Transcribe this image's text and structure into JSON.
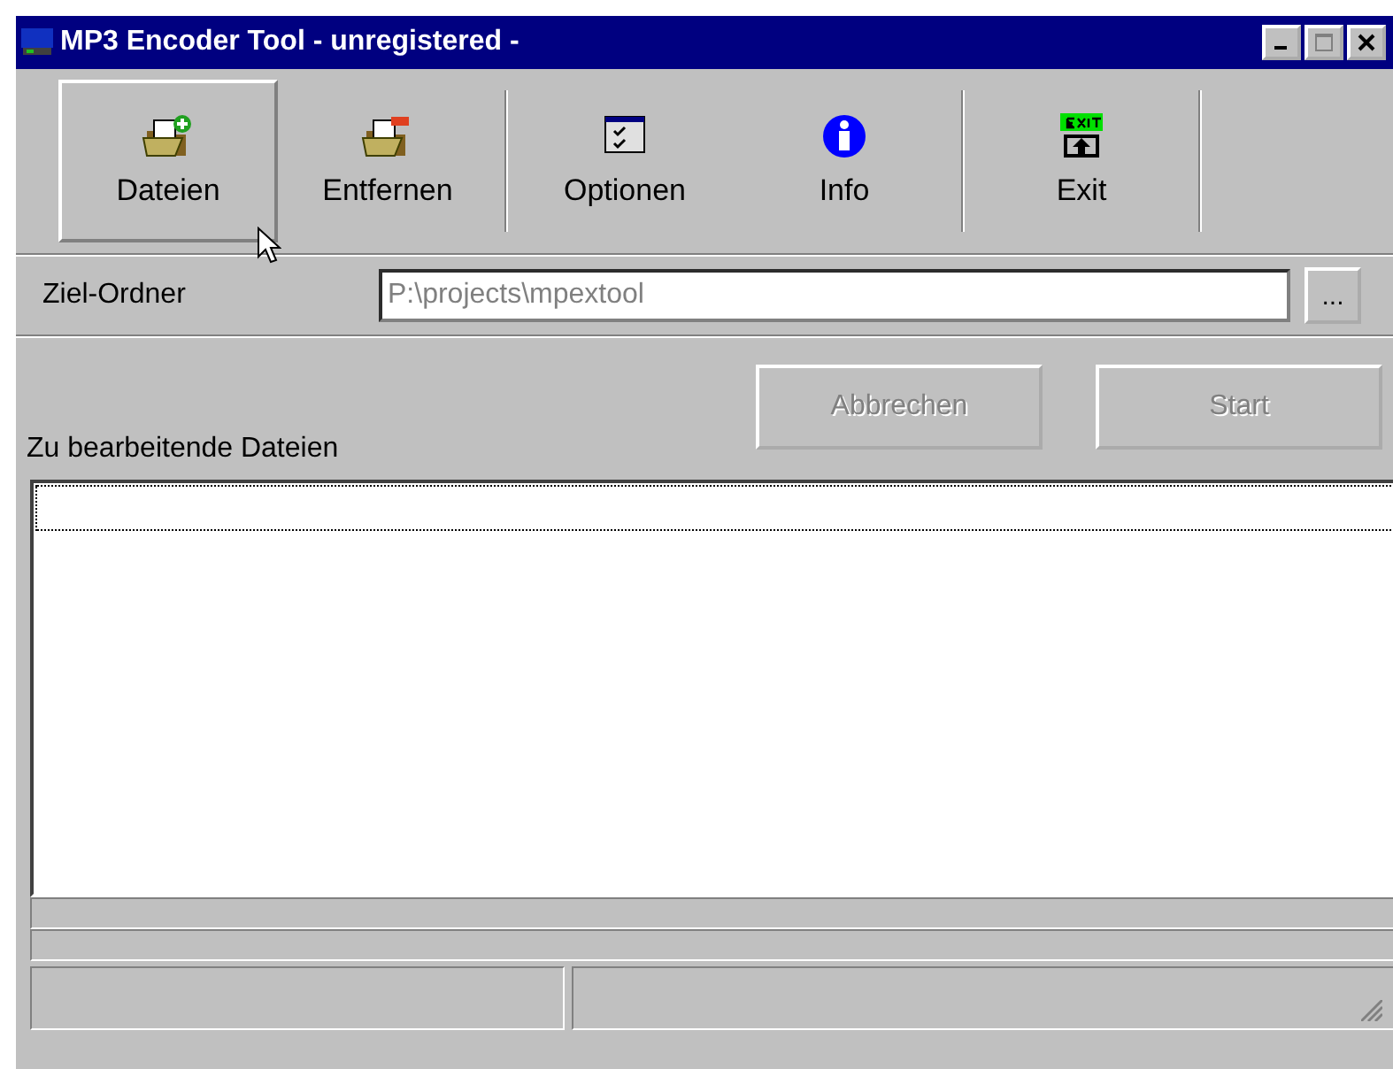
{
  "window": {
    "title": "MP3 Encoder Tool - unregistered -"
  },
  "toolbar": {
    "groups": [
      [
        {
          "label": "Dateien",
          "kind": "add-folder",
          "hovered": true
        },
        {
          "label": "Entfernen",
          "kind": "remove-folder",
          "hovered": false
        }
      ],
      [
        {
          "label": "Optionen",
          "kind": "options",
          "hovered": false
        },
        {
          "label": "Info",
          "kind": "info",
          "hovered": false
        }
      ],
      [
        {
          "label": "Exit",
          "kind": "exit",
          "hovered": false
        }
      ]
    ]
  },
  "target": {
    "label": "Ziel-Ordner",
    "value": "P:\\projects\\mpextool",
    "browse": "..."
  },
  "actions": [
    {
      "label": "Abbrechen",
      "disabled": true
    },
    {
      "label": "Start",
      "disabled": true
    }
  ],
  "files": {
    "label": "Zu bearbeitende Dateien"
  },
  "progress": [
    {
      "level": 0
    },
    {
      "level": 0
    }
  ]
}
